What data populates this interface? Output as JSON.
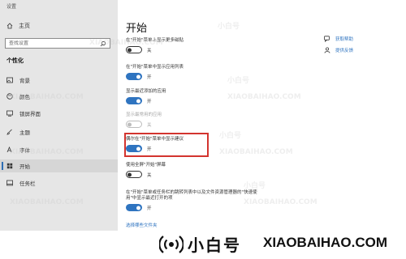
{
  "window": {
    "title": "设置"
  },
  "sidebar": {
    "home_label": "主页",
    "search_placeholder": "查找设置",
    "section_title": "个性化",
    "items": [
      {
        "label": "背景",
        "icon": "image-icon"
      },
      {
        "label": "颜色",
        "icon": "palette-icon"
      },
      {
        "label": "锁屏界面",
        "icon": "lock-screen-icon"
      },
      {
        "label": "主题",
        "icon": "brush-icon"
      },
      {
        "label": "字体",
        "icon": "font-icon"
      },
      {
        "label": "开始",
        "icon": "start-icon",
        "active": true
      },
      {
        "label": "任务栏",
        "icon": "taskbar-icon"
      }
    ]
  },
  "main": {
    "title": "开始",
    "settings": [
      {
        "desc": "在\"开始\"菜单上显示更多磁贴",
        "state": "关",
        "on": false
      },
      {
        "desc": "在\"开始\"菜单中显示应用列表",
        "state": "开",
        "on": true
      },
      {
        "desc": "显示最近添加的应用",
        "state": "开",
        "on": true
      },
      {
        "desc": "显示最常用的应用",
        "state": "关",
        "on": false,
        "disabled": true
      },
      {
        "desc": "偶尔在\"开始\"菜单中显示建议",
        "state": "开",
        "on": true,
        "highlighted": true
      },
      {
        "desc": "使用全屏\"开始\"屏幕",
        "state": "关",
        "on": false
      },
      {
        "desc_line1": "在\"开始\"菜单或任务栏的跳转列表中以及文件资源管理器的\"快速使",
        "desc_line2": "用\"中显示最近打开的项",
        "state": "开",
        "on": true
      }
    ],
    "choose_folders_link": "选择哪些文件夹"
  },
  "help": {
    "get_help": "获取帮助",
    "feedback": "提供反馈"
  },
  "watermark": {
    "cn": "小白号",
    "en": "XIAOBAIHAO.COM"
  },
  "brand": {
    "cn": "小白号",
    "en": "XIAOBAIHAO.COM",
    "accent": "#2f74c0",
    "highlight": "#d3342f"
  }
}
